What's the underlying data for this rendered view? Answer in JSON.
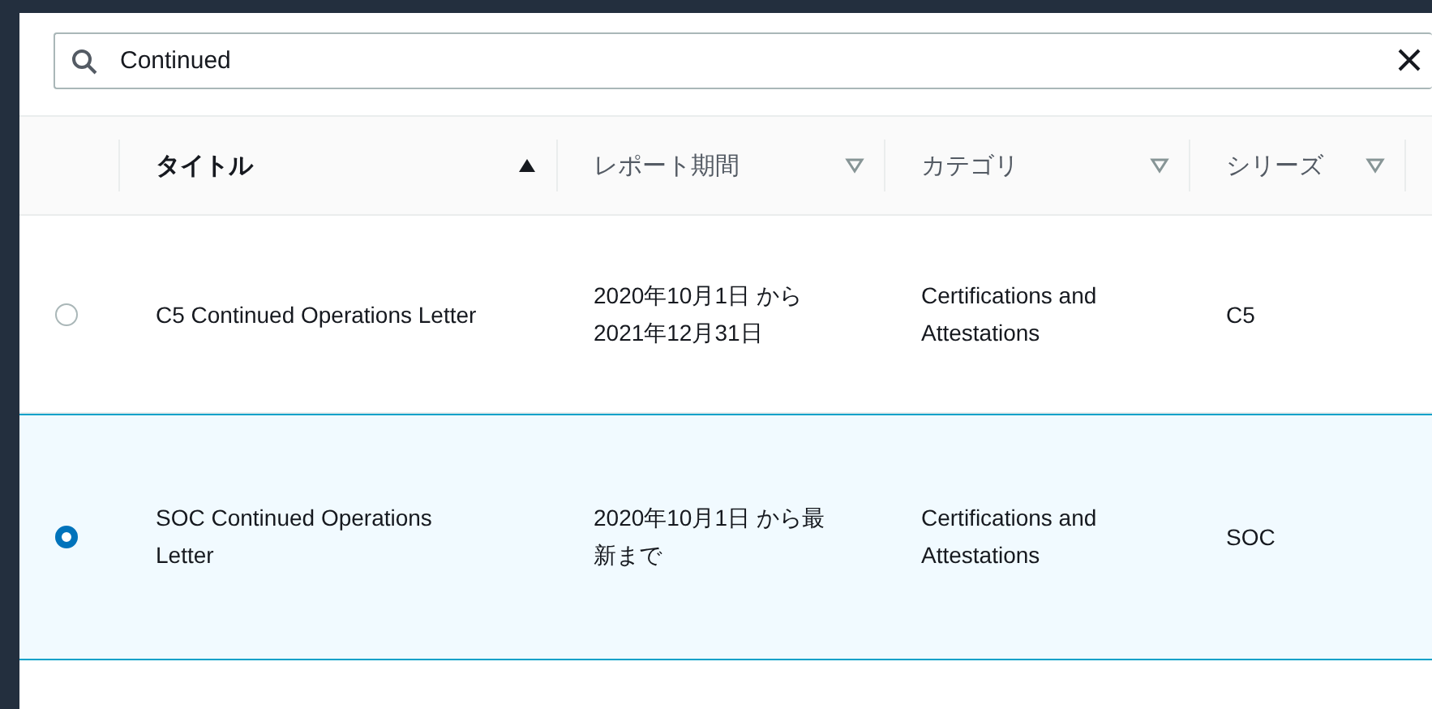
{
  "search": {
    "value": "Continued"
  },
  "table": {
    "columns": [
      {
        "label": "タイトル",
        "sorted": true
      },
      {
        "label": "レポート期間",
        "sorted": false
      },
      {
        "label": "カテゴリ",
        "sorted": false
      },
      {
        "label": "シリーズ",
        "sorted": false
      }
    ],
    "rows": [
      {
        "selected": false,
        "cells": [
          "C5 Continued Operations Letter",
          "2020年10月1日 から 2021年12月31日",
          "Certifications and Attestations",
          "C5"
        ]
      },
      {
        "selected": true,
        "cells": [
          "SOC Continued Operations Letter",
          "2020年10月1日 から最新まで",
          "Certifications and Attestations",
          "SOC"
        ]
      }
    ]
  }
}
